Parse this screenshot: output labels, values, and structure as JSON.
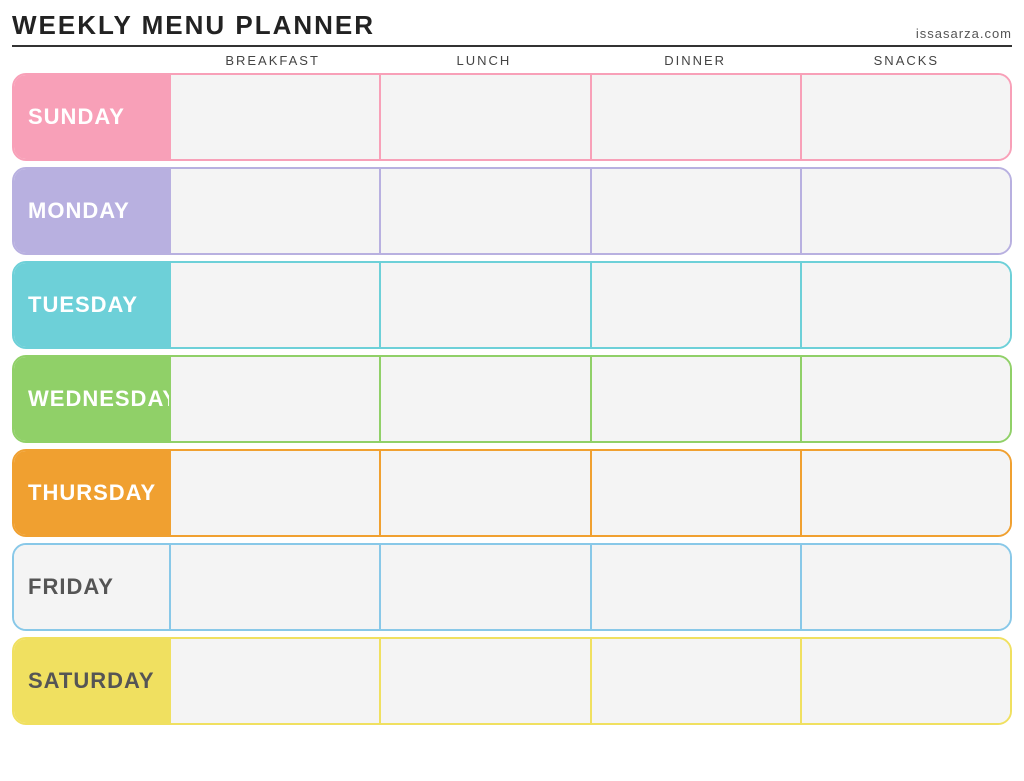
{
  "header": {
    "title": "Weekly Menu Planner",
    "website": "issasarza.com"
  },
  "columns": [
    "",
    "Breakfast",
    "Lunch",
    "Dinner",
    "Snacks"
  ],
  "days": [
    {
      "name": "Sunday",
      "class": "row-sunday"
    },
    {
      "name": "Monday",
      "class": "row-monday"
    },
    {
      "name": "Tuesday",
      "class": "row-tuesday"
    },
    {
      "name": "Wednesday",
      "class": "row-wednesday"
    },
    {
      "name": "Thursday",
      "class": "row-thursday"
    },
    {
      "name": "Friday",
      "class": "row-friday"
    },
    {
      "name": "Saturday",
      "class": "row-saturday"
    }
  ]
}
